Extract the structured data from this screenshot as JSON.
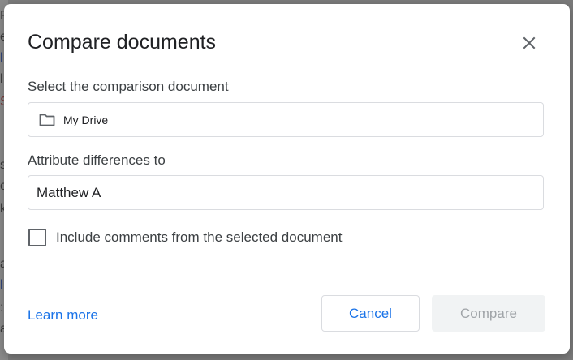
{
  "dialog": {
    "title": "Compare documents",
    "close_icon": "close-icon"
  },
  "comparison": {
    "label": "Select the comparison document",
    "location_icon": "folder-icon",
    "location_text": "My Drive"
  },
  "attribute": {
    "label": "Attribute differences to",
    "value": "Matthew A"
  },
  "include_comments": {
    "label": "Include comments from the selected document",
    "checked": false
  },
  "footer": {
    "learn_more": "Learn more",
    "cancel_label": "Cancel",
    "compare_label": "Compare",
    "compare_enabled": false
  },
  "colors": {
    "accent": "#1a73e8",
    "disabled_bg": "#f1f3f4",
    "disabled_text": "#a0a4a8",
    "overlay": "#7a7a7a"
  }
}
